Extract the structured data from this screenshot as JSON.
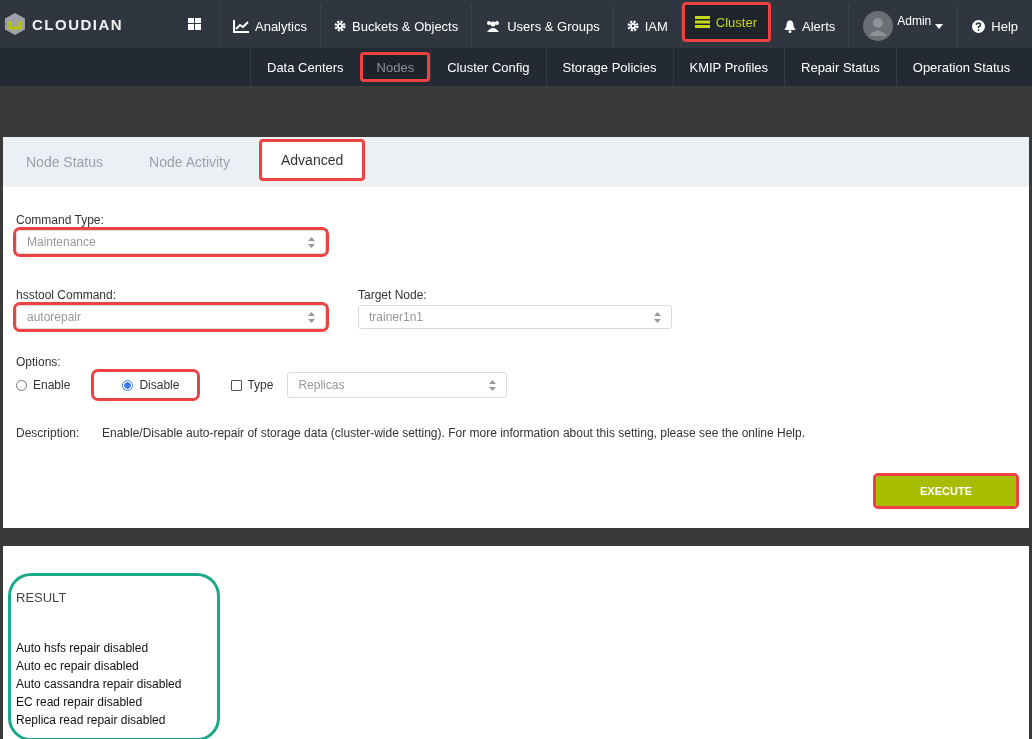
{
  "brand": "CLOUDIAN",
  "nav": [
    {
      "label": "Analytics",
      "selected": false,
      "highlighted": false
    },
    {
      "label": "Buckets & Objects",
      "selected": false,
      "highlighted": false
    },
    {
      "label": "Users & Groups",
      "selected": false,
      "highlighted": false
    },
    {
      "label": "IAM",
      "selected": false,
      "highlighted": false
    },
    {
      "label": "Cluster",
      "selected": true,
      "highlighted": true
    },
    {
      "label": "Alerts",
      "selected": false,
      "highlighted": false
    }
  ],
  "user": {
    "name": "Admin"
  },
  "help": "Help",
  "subnav": [
    {
      "label": "Data Centers",
      "selected": false,
      "highlighted": false
    },
    {
      "label": "Nodes",
      "selected": true,
      "highlighted": true
    },
    {
      "label": "Cluster Config",
      "selected": false,
      "highlighted": false
    },
    {
      "label": "Storage Policies",
      "selected": false,
      "highlighted": false
    },
    {
      "label": "KMIP Profiles",
      "selected": false,
      "highlighted": false
    },
    {
      "label": "Repair Status",
      "selected": false,
      "highlighted": false
    },
    {
      "label": "Operation Status",
      "selected": false,
      "highlighted": false
    }
  ],
  "tabs": [
    {
      "label": "Node Status",
      "selected": false,
      "highlighted": false
    },
    {
      "label": "Node Activity",
      "selected": false,
      "highlighted": false
    },
    {
      "label": "Advanced",
      "selected": true,
      "highlighted": true
    }
  ],
  "command_type": {
    "label": "Command Type:",
    "value": "Maintenance",
    "highlighted": true
  },
  "hsstool_command": {
    "label": "hsstool Command:",
    "value": "autorepair",
    "highlighted": true
  },
  "target_node": {
    "label": "Target Node:",
    "value": "trainer1n1",
    "highlighted": false
  },
  "options": {
    "label": "Options:",
    "radios": [
      {
        "label": "Enable",
        "selected": false,
        "highlighted": false
      },
      {
        "label": "Disable",
        "selected": true,
        "highlighted": true
      }
    ],
    "type_checkbox": {
      "label": "Type",
      "checked": false
    },
    "type_select": {
      "value": "Replicas"
    }
  },
  "description": {
    "label": "Description:",
    "text": "Enable/Disable auto-repair of storage data (cluster-wide setting). For more information about this setting, please see the online Help."
  },
  "execute_button": {
    "label": "EXECUTE",
    "highlighted": true
  },
  "result": {
    "title": "RESULT",
    "highlighted": true,
    "lines": [
      "Auto hsfs repair disabled",
      "Auto ec repair disabled",
      "Auto cassandra repair disabled",
      "EC read repair disabled",
      "Replica read repair disabled"
    ]
  }
}
